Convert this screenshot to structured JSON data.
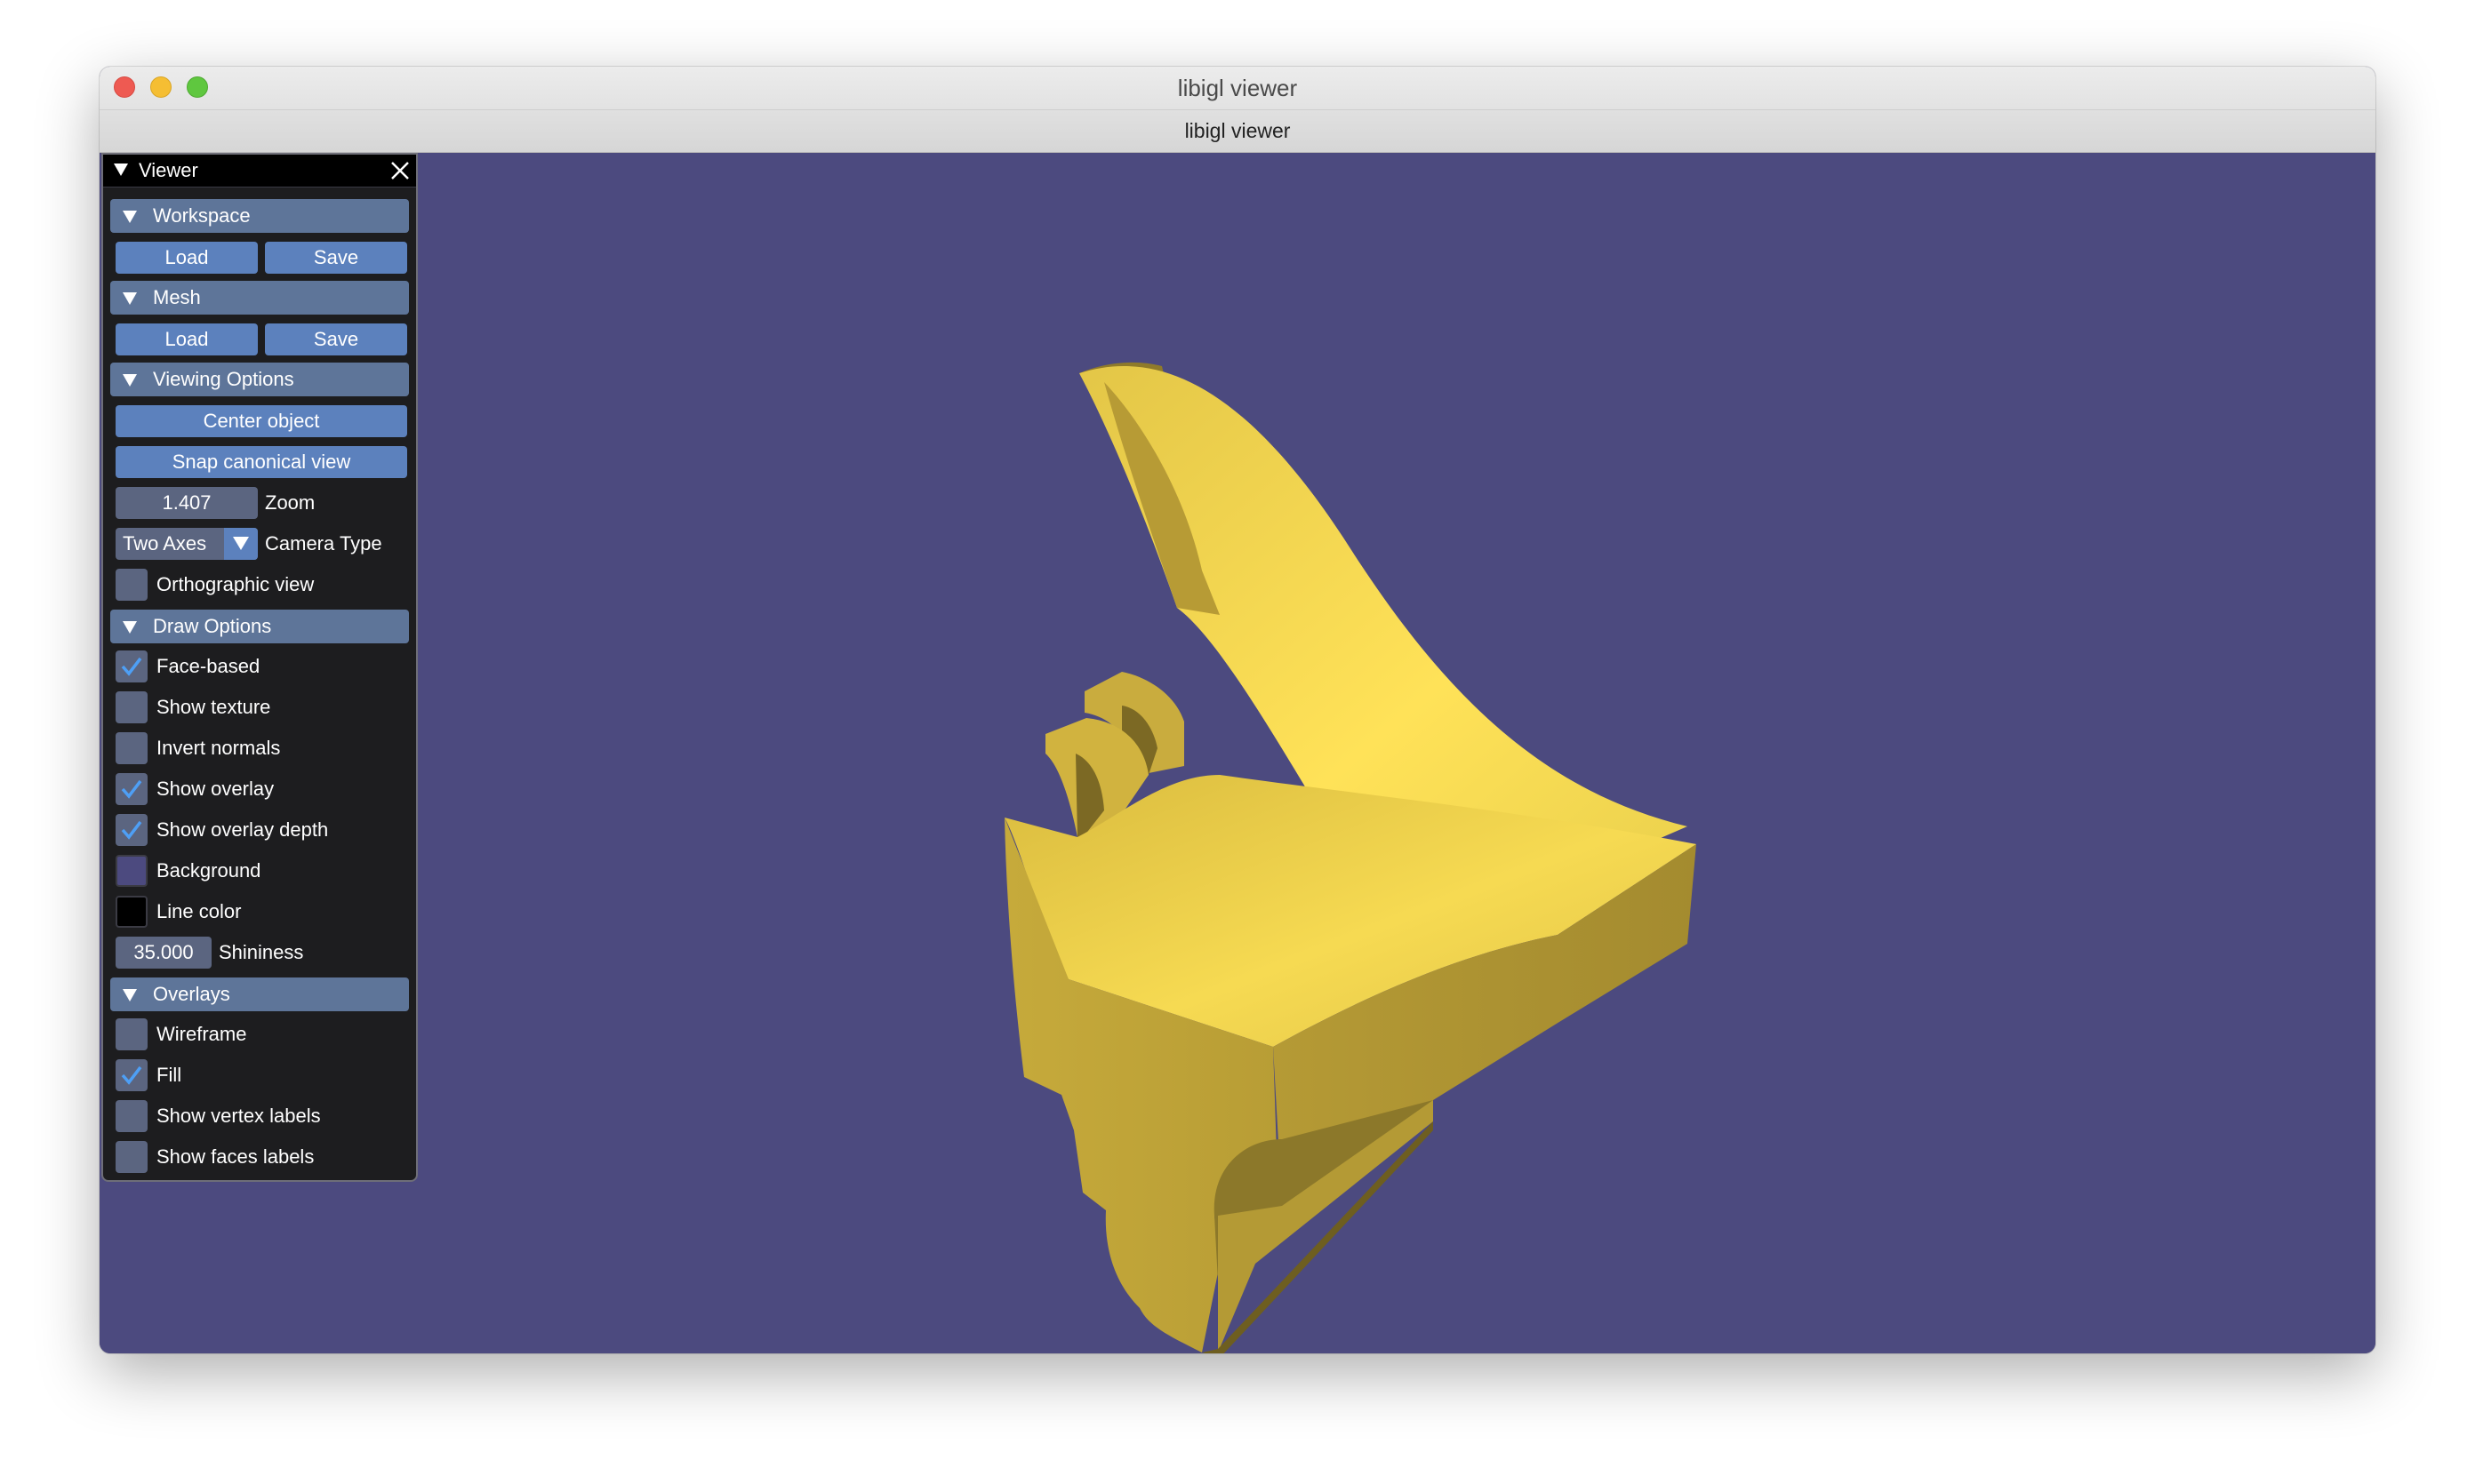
{
  "window": {
    "title": "libigl viewer",
    "tab_title": "libigl viewer"
  },
  "colors": {
    "background": "#4c4a7f",
    "panel_bg": "#1d1d1f",
    "header": "#5e7599",
    "button": "#5c81bd",
    "field": "#5b6580",
    "mesh": "#e6c84a",
    "line_color": "#000000"
  },
  "panel": {
    "title": "Viewer",
    "workspace": {
      "header": "Workspace",
      "load": "Load",
      "save": "Save"
    },
    "mesh": {
      "header": "Mesh",
      "load": "Load",
      "save": "Save"
    },
    "viewing": {
      "header": "Viewing Options",
      "center_object": "Center object",
      "snap_canonical": "Snap canonical view",
      "zoom_value": "1.407",
      "zoom_label": "Zoom",
      "camera_value": "Two Axes",
      "camera_label": "Camera Type",
      "orthographic_label": "Orthographic view",
      "orthographic_checked": false
    },
    "draw": {
      "header": "Draw Options",
      "face_based": "Face-based",
      "show_texture": "Show texture",
      "invert_normals": "Invert normals",
      "show_overlay": "Show overlay",
      "show_overlay_depth": "Show overlay depth",
      "background": "Background",
      "line_color": "Line color",
      "shininess_value": "35.000",
      "shininess_label": "Shininess",
      "checked": {
        "face_based": true,
        "show_texture": false,
        "invert_normals": false,
        "show_overlay": true,
        "show_overlay_depth": true
      }
    },
    "overlays": {
      "header": "Overlays",
      "wireframe": "Wireframe",
      "fill": "Fill",
      "show_vertex_labels": "Show vertex labels",
      "show_faces_labels": "Show faces labels",
      "checked": {
        "wireframe": false,
        "fill": true,
        "show_vertex_labels": false,
        "show_faces_labels": false
      }
    }
  }
}
